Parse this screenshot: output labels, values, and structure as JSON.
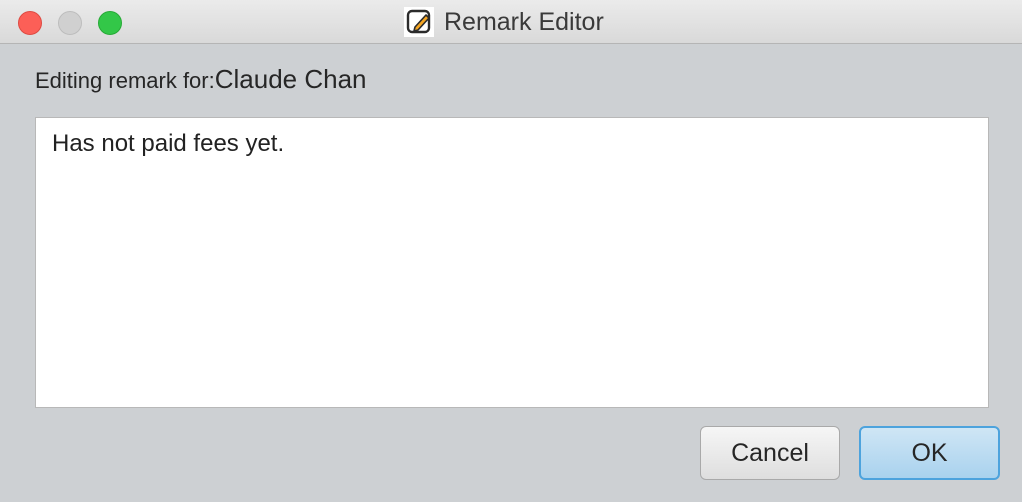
{
  "window": {
    "title": "Remark Editor",
    "app_icon": "note-pencil-icon"
  },
  "editor": {
    "label_prefix": "Editing remark for:",
    "person_name": "Claude Chan",
    "remark_text": "Has not paid fees yet."
  },
  "buttons": {
    "cancel_label": "Cancel",
    "ok_label": "OK"
  },
  "colors": {
    "close": "#fc5f57",
    "minimize": "#d0d0d0",
    "zoom": "#33c748",
    "ok_border": "#4da3dd",
    "icon_accent": "#f5a623"
  }
}
